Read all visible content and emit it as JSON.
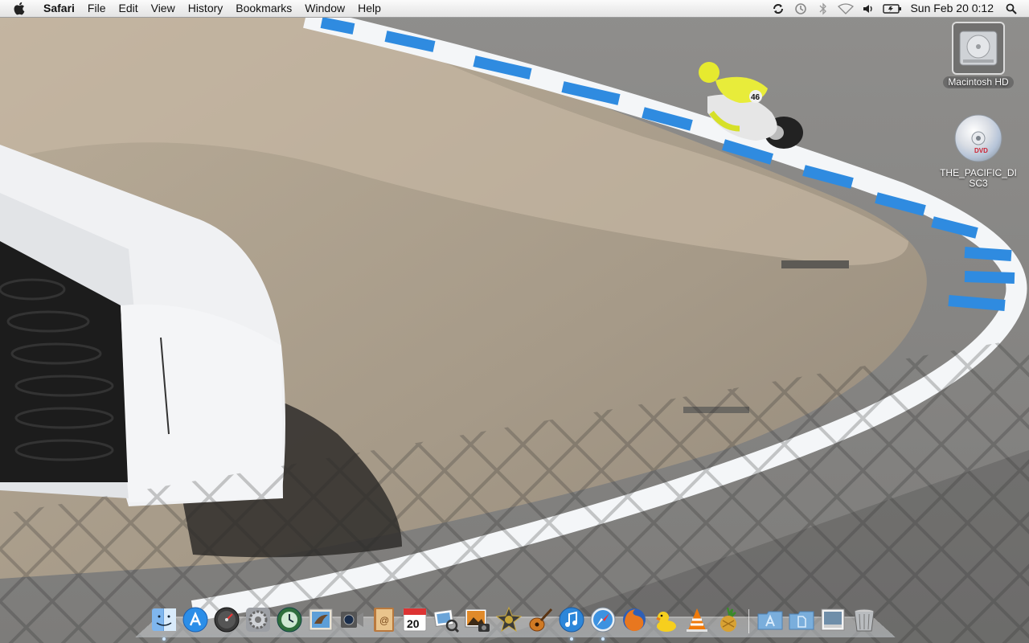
{
  "menubar": {
    "app_name": "Safari",
    "menus": [
      "File",
      "Edit",
      "View",
      "History",
      "Bookmarks",
      "Window",
      "Help"
    ],
    "status_icons": [
      "sync-icon",
      "time-machine-icon",
      "bluetooth-icon",
      "wifi-icon",
      "volume-icon",
      "battery-icon"
    ],
    "clock": "Sun Feb 20  0:12",
    "spotlight_icon": "spotlight-search-icon"
  },
  "desktop": {
    "wallpaper": "motorcycle-racer-on-track-corner",
    "icons": [
      {
        "name": "macintosh-hd",
        "label": "Macintosh HD",
        "icon": "hard-drive-icon",
        "selected": true
      },
      {
        "name": "the-pacific-disc3",
        "label": "THE_PACIFIC_DISC3",
        "icon": "dvd-icon",
        "selected": false
      }
    ]
  },
  "dock": {
    "apps": [
      {
        "name": "finder",
        "icon": "finder-icon",
        "running": true
      },
      {
        "name": "app-store",
        "icon": "app-store-icon",
        "running": false
      },
      {
        "name": "dashboard",
        "icon": "dashboard-icon",
        "running": false
      },
      {
        "name": "system-preferences",
        "icon": "system-preferences-icon",
        "running": false
      },
      {
        "name": "time-machine",
        "icon": "time-machine-icon",
        "running": false
      },
      {
        "name": "mail",
        "icon": "mail-icon",
        "running": false
      },
      {
        "name": "facetime",
        "icon": "facetime-icon",
        "running": false
      },
      {
        "name": "address-book",
        "icon": "address-book-icon",
        "running": false
      },
      {
        "name": "ical",
        "icon": "calendar-icon",
        "running": false,
        "date_text": "20"
      },
      {
        "name": "preview",
        "icon": "preview-icon",
        "running": false
      },
      {
        "name": "iphoto",
        "icon": "iphoto-icon",
        "running": false
      },
      {
        "name": "imovie",
        "icon": "imovie-icon",
        "running": false
      },
      {
        "name": "garageband",
        "icon": "garageband-icon",
        "running": false
      },
      {
        "name": "itunes",
        "icon": "itunes-icon",
        "running": true
      },
      {
        "name": "safari",
        "icon": "safari-icon",
        "running": true
      },
      {
        "name": "firefox",
        "icon": "firefox-icon",
        "running": false
      },
      {
        "name": "cyberduck",
        "icon": "cyberduck-icon",
        "running": false
      },
      {
        "name": "vlc",
        "icon": "vlc-icon",
        "running": false
      },
      {
        "name": "adium",
        "icon": "adium-icon",
        "running": false
      }
    ],
    "stacks": [
      {
        "name": "applications-stack",
        "icon": "applications-folder-icon"
      },
      {
        "name": "documents-stack",
        "icon": "documents-folder-icon"
      },
      {
        "name": "downloads-stack",
        "icon": "downloads-stack-icon"
      },
      {
        "name": "trash",
        "icon": "trash-icon"
      }
    ]
  }
}
